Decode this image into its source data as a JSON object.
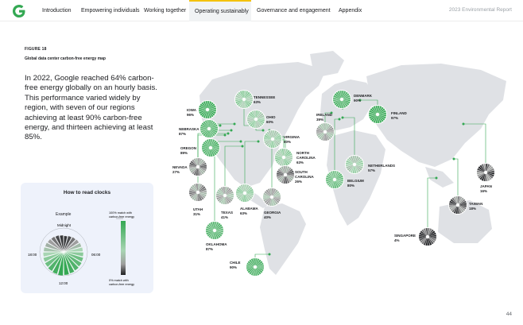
{
  "nav": {
    "tabs": [
      {
        "label": "Introduction",
        "active": false
      },
      {
        "label": "Empowering individuals",
        "active": false
      },
      {
        "label": "Working together",
        "active": false
      },
      {
        "label": "Operating sustainably",
        "active": true
      },
      {
        "label": "Governance and engagement",
        "active": false
      },
      {
        "label": "Appendix",
        "active": false
      }
    ],
    "report_title": "2023 Environmental Report",
    "accent_color": "#f4c20d"
  },
  "figure": {
    "label": "FIGURE 18",
    "title": "Global data center carbon-free energy map"
  },
  "intro_text": "In 2022, Google reached 64% carbon-free energy globally on an hourly basis. This performance varied widely by region, with seven of our regions achieving at least 90% carbon-free energy, and thirteen achieving at least 85%.",
  "legend": {
    "title": "How to read clocks",
    "example": "Example",
    "midnight": "Midnight",
    "hour6": "06:00",
    "hour12": "12:00",
    "hour18": "18:00",
    "top_label_1": "100% match with",
    "top_label_2": "carbon-free energy",
    "bottom_label_1": "0% match with",
    "bottom_label_2": "carbon-free energy"
  },
  "regions": [
    {
      "name": "TENNESSEE",
      "value": 63
    },
    {
      "name": "IOWA",
      "value": 96
    },
    {
      "name": "OHIO",
      "value": 60
    },
    {
      "name": "NEBRASKA",
      "value": 87
    },
    {
      "name": "VIRGINIA",
      "value": 60
    },
    {
      "name": "OREGON",
      "value": 89
    },
    {
      "name": "NORTH CAROLINA",
      "value": 63
    },
    {
      "name": "NEVADA",
      "value": 27
    },
    {
      "name": "SOUTH CAROLINA",
      "value": 26
    },
    {
      "name": "UTAH",
      "value": 31
    },
    {
      "name": "TEXAS",
      "value": 41
    },
    {
      "name": "ALABAMA",
      "value": 63
    },
    {
      "name": "GEORGIA",
      "value": 40
    },
    {
      "name": "OKLAHOMA",
      "value": 87
    },
    {
      "name": "CHILE",
      "value": 90
    },
    {
      "name": "IRELAND",
      "value": 39
    },
    {
      "name": "DENMARK",
      "value": 90
    },
    {
      "name": "FINLAND",
      "value": 97
    },
    {
      "name": "NETHERLANDS",
      "value": 57
    },
    {
      "name": "BELGIUM",
      "value": 80
    },
    {
      "name": "JAPAN",
      "value": 16
    },
    {
      "name": "TAIWAN",
      "value": 18
    },
    {
      "name": "SINGAPORE",
      "value": 4
    }
  ],
  "page_number": "44",
  "colors": {
    "green": "#34a853",
    "gray": "#bdbdbd",
    "dark": "#202124",
    "map": "#dfe1e5"
  }
}
